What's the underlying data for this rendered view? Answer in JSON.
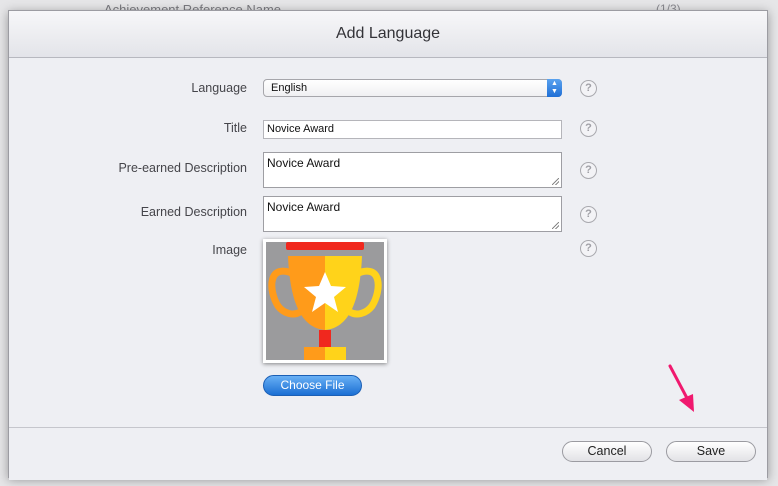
{
  "background": {
    "peek_text": "Achievement Reference Name",
    "peek_right": "(1/3)"
  },
  "dialog": {
    "title": "Add Language",
    "help_glyph": "?",
    "language": {
      "label": "Language",
      "value": "English"
    },
    "title_field": {
      "label": "Title",
      "value": "Novice Award"
    },
    "pre_earned": {
      "label": "Pre-earned Description",
      "value": "Novice Award"
    },
    "earned": {
      "label": "Earned Description",
      "value": "Novice Award"
    },
    "image": {
      "label": "Image",
      "icon": "trophy-icon"
    },
    "choose_file_label": "Choose File",
    "cancel_label": "Cancel",
    "save_label": "Save"
  },
  "colors": {
    "accent": "#1f6fd6",
    "trophy_orange": "#ff9b1a",
    "trophy_yellow": "#ffd31a",
    "trophy_red": "#f0281e",
    "annotation_arrow": "#f0196e"
  }
}
